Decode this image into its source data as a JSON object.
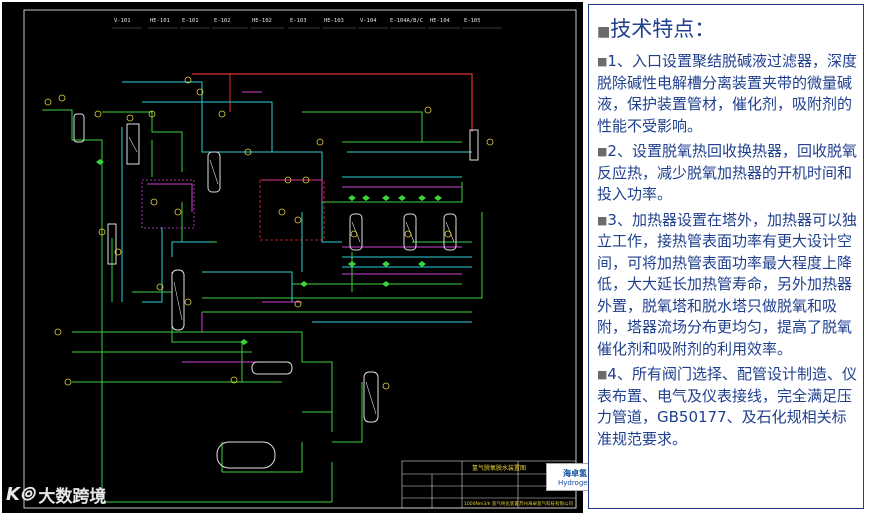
{
  "drawing": {
    "title_block": {
      "project": "氢气脱氧脱水装置图",
      "drawing_name": "1000Nm3/h 氢气纯化装置",
      "company": "苏州海卓氢气科技有限公司"
    },
    "equipment_tags": [
      "V-101",
      "HE-101",
      "E-101",
      "E-102",
      "HE-102",
      "E-103",
      "HE-103",
      "V-104",
      "E-104A/B/C",
      "HE-104",
      "E-105"
    ],
    "logo": {
      "cn": "海卓氢",
      "en": "Hydrogen"
    }
  },
  "watermark": {
    "brand": "大数跨境"
  },
  "panel": {
    "title": "技术特点：",
    "bullet": "■",
    "points": [
      "1、入口设置聚结脱碱液过滤器，深度脱除碱性电解槽分离装置夹带的微量碱液，保护装置管材，催化剂，吸附剂的性能不受影响。",
      "2、设置脱氧热回收换热器，回收脱氧反应热，减少脱氧加热器的开机时间和投入功率。",
      "3、加热器设置在塔外，加热器可以独立工作，接热管表面功率有更大设计空间，可将加热管表面功率最大程度上降低，大大延长加热管寿命，另外加热器外置，脱氧塔和脱水塔只做脱氧和吸附，塔器流场分布更均匀，提高了脱氧催化剂和吸附剂的利用效率。",
      "4、所有阀门选择、配管设计制造、仪表布置、电气及仪表接线，完全满足压力管道，GB50177、及石化规相关标准规范要求。"
    ]
  }
}
